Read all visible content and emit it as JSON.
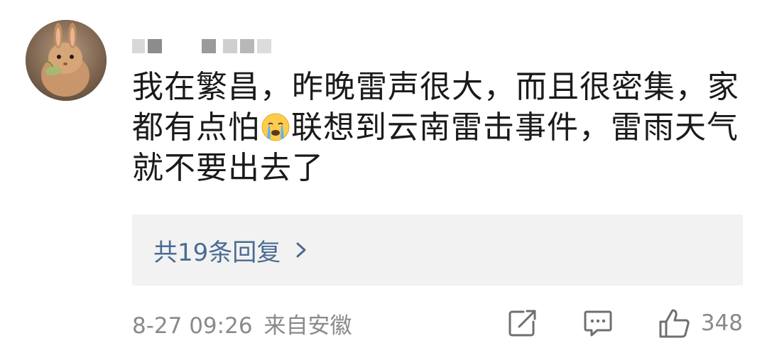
{
  "comment": {
    "text_part1": "我在繁昌，昨晚雷声很大，而且很密集，家都有点怕",
    "emoji": "crying-emoji",
    "text_part2": "联想到云南雷击事件，雷雨天气就不要出去了",
    "reply_link_label": "共19条回复",
    "timestamp": "8-27 09:26",
    "location": "来自安徽",
    "like_count": "348"
  },
  "icons": {
    "share": "share-icon",
    "comment": "comment-icon",
    "like": "thumbs-up-icon",
    "chevron": "chevron-right-icon"
  },
  "colors": {
    "text": "#1a1a1a",
    "link": "#4a6b93",
    "meta": "#8a8a8a",
    "reply_box_bg": "#f2f2f2"
  }
}
